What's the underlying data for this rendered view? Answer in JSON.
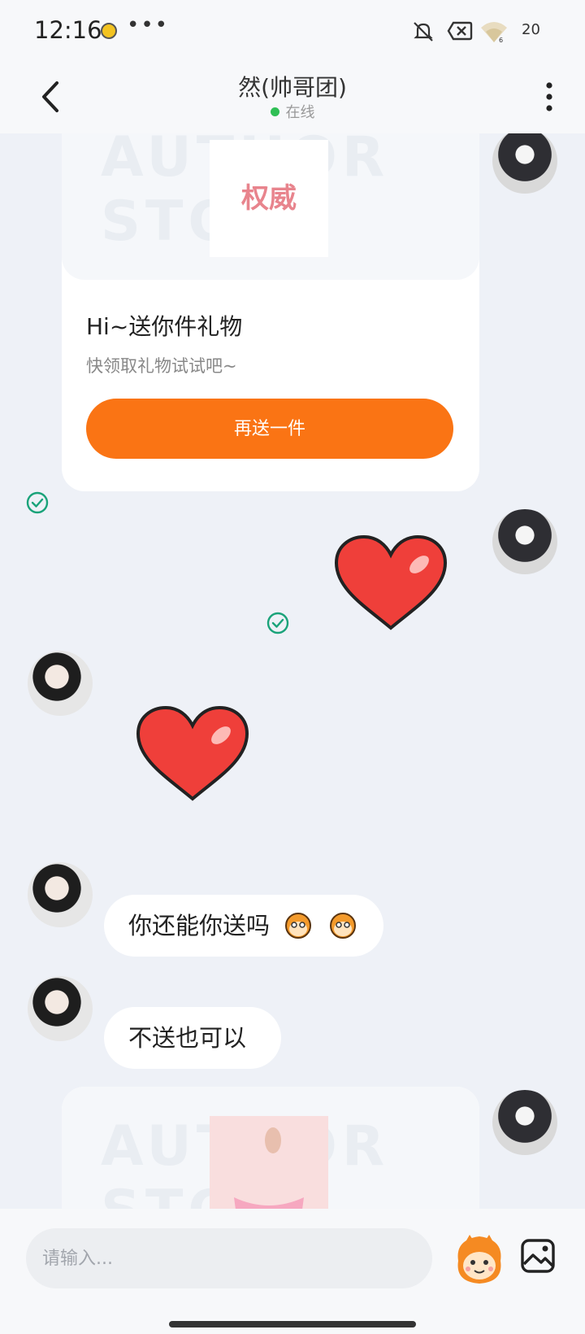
{
  "status_bar": {
    "time": "12:16",
    "battery": "20"
  },
  "header": {
    "title": "然(帅哥团)",
    "presence": "在线",
    "accent_online": "#2fbf55"
  },
  "gift_card": {
    "image_text": "权威",
    "watermark": "AUTHOR STORE",
    "title": "Hi~送你件礼物",
    "subtitle": "快领取礼物试试吧~",
    "button_label": "再送一件",
    "button_color": "#fa7414"
  },
  "messages": [
    {
      "side": "left",
      "text": "你还能你送吗"
    },
    {
      "side": "left",
      "text": "不送也可以"
    }
  ],
  "input": {
    "placeholder": "请输入..."
  },
  "icons": [
    "back-arrow-icon",
    "more-vert-icon",
    "check-circle-icon",
    "heart-sticker",
    "emoji-icon",
    "image-icon"
  ]
}
